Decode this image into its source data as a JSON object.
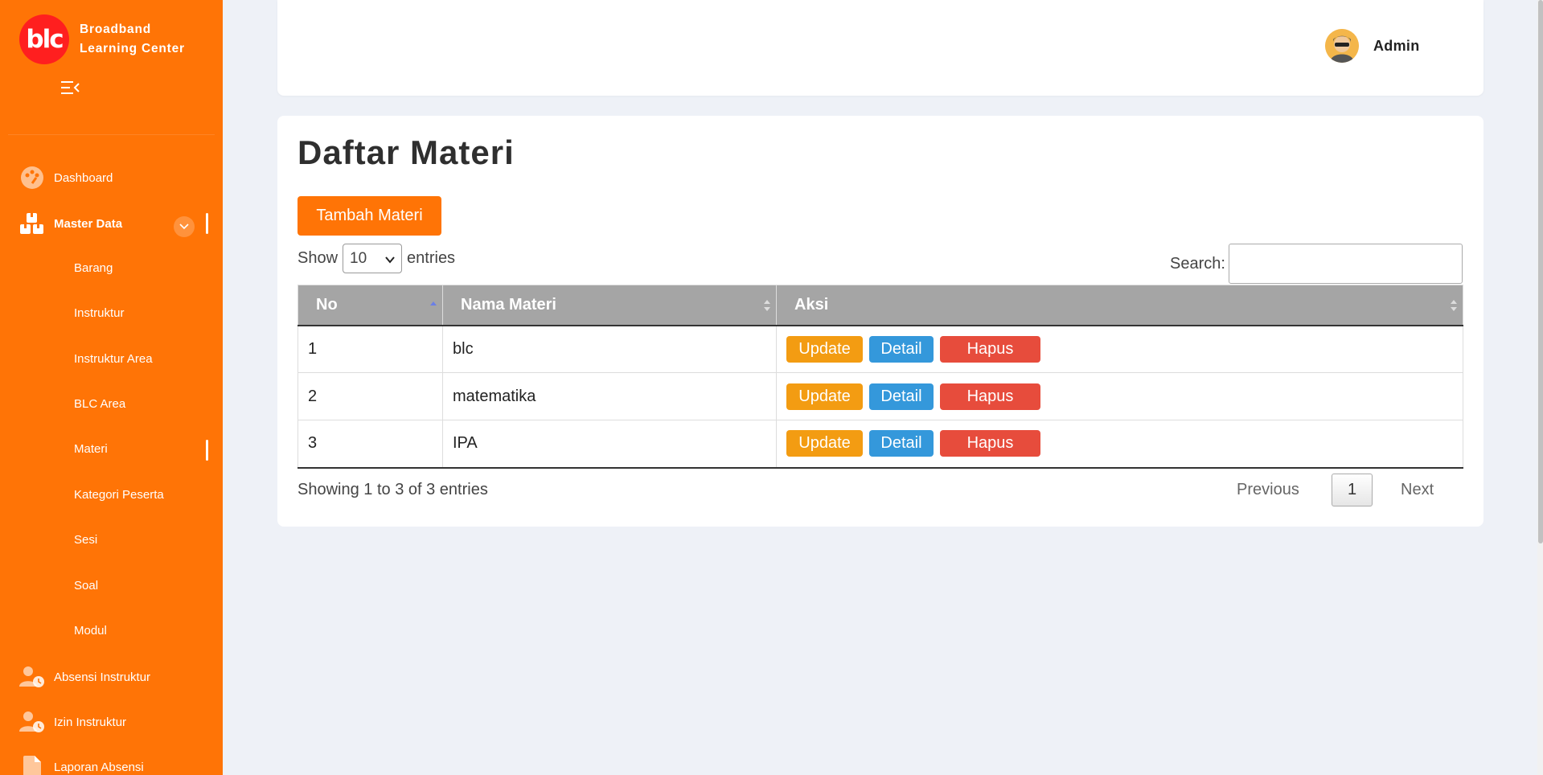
{
  "sidebar": {
    "logo_text": "blc",
    "brand_line1": "Broadband",
    "brand_line2": "Learning Center",
    "items": [
      {
        "label": "Dashboard",
        "icon": "palette-icon"
      },
      {
        "label": "Master Data",
        "icon": "boxes-icon"
      },
      {
        "label": "Absensi Instruktur",
        "icon": "user-clock-icon"
      },
      {
        "label": "Izin Instruktur",
        "icon": "user-clock-icon"
      },
      {
        "label": "Laporan Absensi",
        "icon": "file-icon"
      }
    ],
    "sub_items": [
      "Barang",
      "Instruktur",
      "Instruktur Area",
      "BLC Area",
      "Materi",
      "Kategori Peserta",
      "Sesi",
      "Soal",
      "Modul"
    ],
    "active_sub": "Materi"
  },
  "header": {
    "user_name": "Admin"
  },
  "main": {
    "title": "Daftar Materi",
    "add_button": "Tambah Materi",
    "show_label": "Show",
    "entries_label": "entries",
    "page_length": "10",
    "search_label": "Search:",
    "search_value": "",
    "columns": [
      "No",
      "Nama Materi",
      "Aksi"
    ],
    "rows": [
      {
        "no": "1",
        "nama": "blc"
      },
      {
        "no": "2",
        "nama": "matematika"
      },
      {
        "no": "3",
        "nama": "IPA"
      }
    ],
    "actions": {
      "update": "Update",
      "detail": "Detail",
      "hapus": "Hapus"
    },
    "info": "Showing 1 to 3 of 3 entries",
    "pagination": {
      "previous": "Previous",
      "current": "1",
      "next": "Next"
    }
  },
  "colors": {
    "sidebar": "#ff7406",
    "update": "#f39c12",
    "detail": "#3498db",
    "hapus": "#e74c3c",
    "table_header": "#a5a5a5"
  }
}
